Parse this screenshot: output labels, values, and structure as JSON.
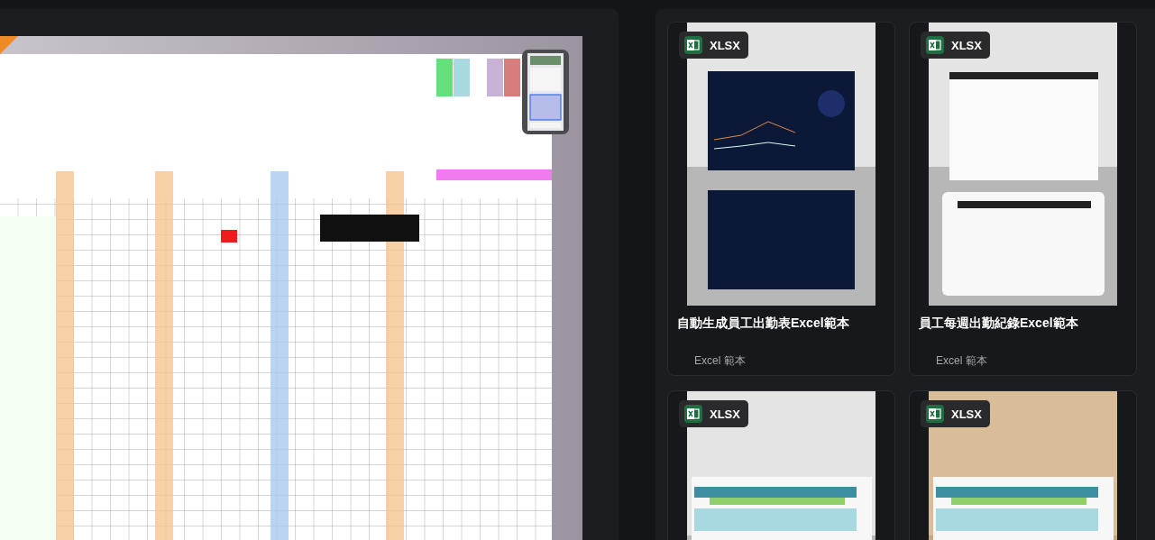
{
  "cards": [
    {
      "badge": "XLSX",
      "title": "自動生成員工出勤表Excel範本",
      "category": "Excel 範本"
    },
    {
      "badge": "XLSX",
      "title": "員工每週出勤紀錄Excel範本",
      "category": "Excel 範本"
    },
    {
      "badge": "XLSX"
    },
    {
      "badge": "XLSX"
    }
  ]
}
